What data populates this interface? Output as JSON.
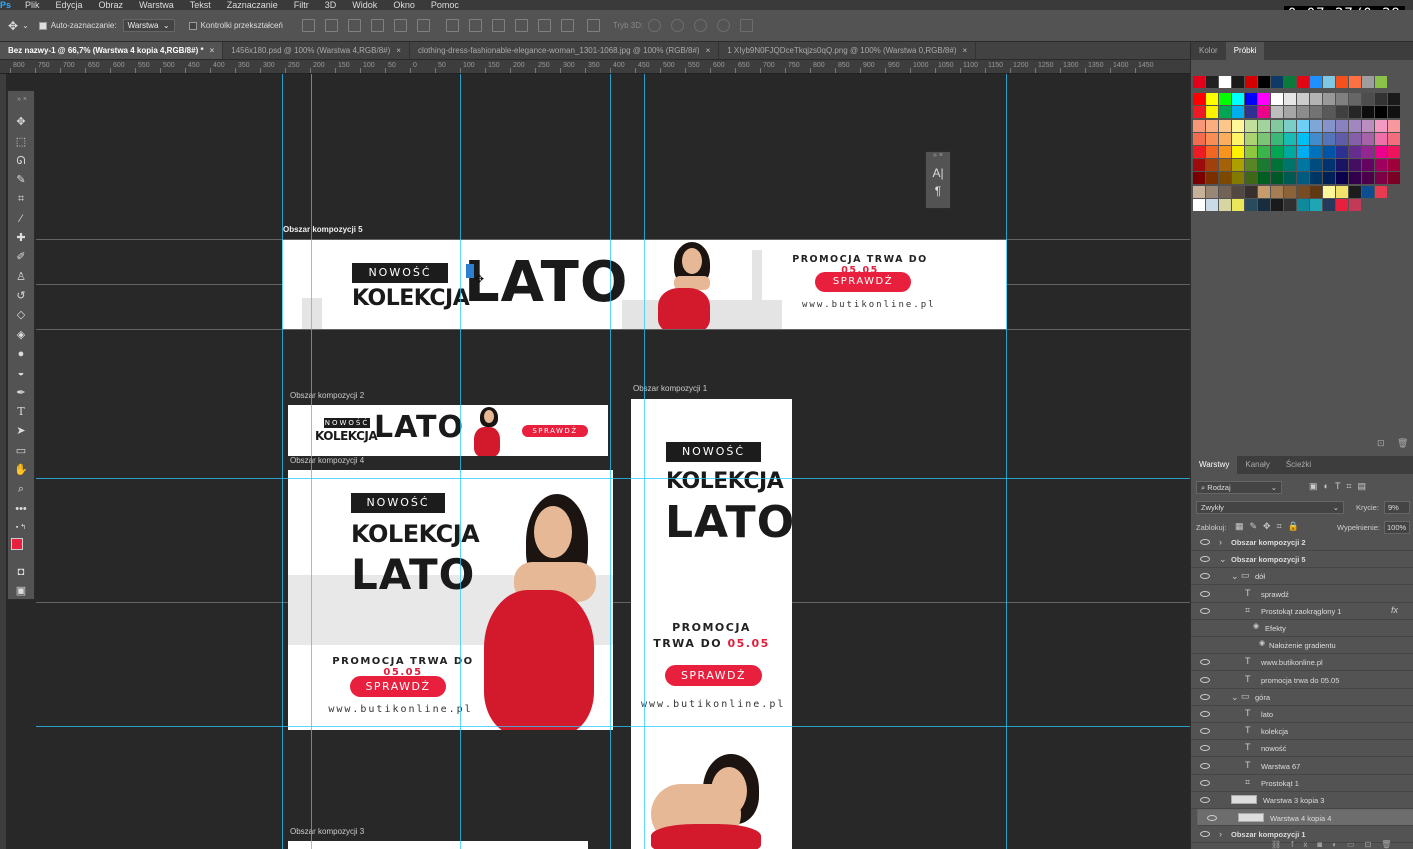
{
  "menu": {
    "app_logo": "Ps",
    "items": [
      "Plik",
      "Edycja",
      "Obraz",
      "Warstwa",
      "Tekst",
      "Zaznaczanie",
      "Filtr",
      "3D",
      "Widok",
      "Okno",
      "Pomoc"
    ]
  },
  "timer": "0:07:27/0:29",
  "options": {
    "auto_select_label": "Auto-zaznaczanie:",
    "auto_select_value": "Warstwa",
    "transform_controls_label": "Kontrolki przekształceń",
    "mode_3d_label": "Tryb 3D:"
  },
  "doc_tabs": [
    {
      "label": "Bez nazwy-1 @ 66,7% (Warstwa 4 kopia 4,RGB/8#) *",
      "active": true
    },
    {
      "label": "1456x180.psd @ 100% (Warstwa 4,RGB/8#)",
      "active": false
    },
    {
      "label": "clothing-dress-fashionable-elegance-woman_1301-1068.jpg @ 100% (RGB/8#)",
      "active": false
    },
    {
      "label": "1 XIyb9N0FJQDceTkqjzs0qQ.png @ 100% (Warstwa 0,RGB/8#)",
      "active": false
    }
  ],
  "ruler_labels": [
    "800",
    "750",
    "700",
    "650",
    "600",
    "550",
    "500",
    "450",
    "400",
    "350",
    "300",
    "250",
    "200",
    "150",
    "100",
    "50",
    "0",
    "50",
    "100",
    "150",
    "200",
    "250",
    "300",
    "350",
    "400",
    "450",
    "500",
    "550",
    "600",
    "650",
    "700",
    "750",
    "800",
    "850",
    "900",
    "950",
    "1000",
    "1050",
    "1100",
    "1150",
    "1200",
    "1250",
    "1300",
    "1350",
    "1400",
    "1450"
  ],
  "artboards": {
    "a5": {
      "label": "Obszar kompozycji 5",
      "nowosc": "NOWOŚĆ",
      "kolekcja": "KOLEKCJA",
      "lato": "LATO",
      "promo": "PROMOCJA TRWA DO",
      "date": "05.05",
      "button": "SPRAWDŹ",
      "www": "www.butikonline.pl"
    },
    "a2": {
      "label": "Obszar kompozycji 2",
      "nowosc": "NOWOŚĆ",
      "kolekcja": "KOLEKCJA",
      "lato": "LATO",
      "button": "SPRAWDŹ"
    },
    "a4": {
      "label": "Obszar kompozycji 4",
      "nowosc": "NOWOŚĆ",
      "kolekcja": "KOLEKCJA",
      "lato": "LATO",
      "promo": "PROMOCJA TRWA DO",
      "date": "05.05",
      "button": "SPRAWDŹ",
      "www": "www.butikonline.pl"
    },
    "a1": {
      "label": "Obszar kompozycji 1",
      "nowosc": "NOWOŚĆ",
      "kolekcja": "KOLEKCJA",
      "lato": "LATO",
      "promo1": "PROMOCJA",
      "promo2": "TRWA DO",
      "date": "05.05",
      "button": "SPRAWDŹ",
      "www": "www.butikonline.pl"
    },
    "a3": {
      "label": "Obszar kompozycji 3"
    }
  },
  "mini_panel": {
    "char_glyph": "A|",
    "para_glyph": "¶"
  },
  "color_panel": {
    "tabs": [
      "Kolor",
      "Próbki"
    ],
    "active": "Próbki"
  },
  "swatch_rows": [
    [
      "#e2001a",
      "#222222",
      "#ffffff",
      "#1a1a1a",
      "#d40000",
      "#000000",
      "#0d3b66",
      "#0b7a3b",
      "#e30613",
      "#1e90ff",
      "#7ec8e3",
      "#f4511e",
      "#ff7043",
      "#9e9e9e",
      "#8bc34a"
    ],
    [
      "#ff0000",
      "#ffff00",
      "#00ff00",
      "#00ffff",
      "#0000ff",
      "#ff00ff",
      "#ffffff",
      "#e6e6e6",
      "#cccccc",
      "#b3b3b3",
      "#999999",
      "#808080",
      "#666666",
      "#4d4d4d",
      "#333333",
      "#1a1a1a"
    ],
    [
      "#ed1c24",
      "#fff200",
      "#00a651",
      "#00aeef",
      "#2e3192",
      "#ec008c",
      "#bdbdbd",
      "#a6a6a6",
      "#8c8c8c",
      "#737373",
      "#595959",
      "#404040",
      "#262626",
      "#0d0d0d",
      "#000000",
      "#111111"
    ],
    [
      "#f7977a",
      "#f9ad81",
      "#fdc68a",
      "#fff79a",
      "#c4df9b",
      "#a3d39c",
      "#82ca9d",
      "#7bcdc8",
      "#6ecff6",
      "#7ea7d8",
      "#8493ca",
      "#8882be",
      "#a187be",
      "#bc8dbf",
      "#f49ac2",
      "#f6989d"
    ],
    [
      "#f26c4f",
      "#f68e55",
      "#fbaf5c",
      "#fff467",
      "#acd372",
      "#7cc576",
      "#3bb878",
      "#1abbb4",
      "#00bff3",
      "#438ccb",
      "#5574b9",
      "#605ca8",
      "#855fa8",
      "#a763a8",
      "#f06ea9",
      "#f26d7d"
    ],
    [
      "#ed1c24",
      "#f26522",
      "#f7941d",
      "#fff200",
      "#8dc63f",
      "#39b54a",
      "#00a651",
      "#00a99d",
      "#00aeef",
      "#0072bc",
      "#0054a6",
      "#2e3192",
      "#662d91",
      "#92278f",
      "#ec008c",
      "#ed145b"
    ],
    [
      "#9e0b0f",
      "#a0410d",
      "#a36209",
      "#aba000",
      "#598527",
      "#1a7b30",
      "#007236",
      "#00746b",
      "#0076a3",
      "#004b80",
      "#003471",
      "#1b1464",
      "#440e62",
      "#630460",
      "#9e005d",
      "#9e0039"
    ],
    [
      "#790000",
      "#7b2e00",
      "#7d4900",
      "#827b00",
      "#406618",
      "#005e20",
      "#005826",
      "#005952",
      "#005b7f",
      "#003663",
      "#002157",
      "#0d004c",
      "#32004b",
      "#4b0049",
      "#7b0046",
      "#7a0026"
    ],
    [
      "#c7b299",
      "#998675",
      "#736357",
      "#534741",
      "#37302d",
      "#c69c6d",
      "#a67c52",
      "#8c6239",
      "#754c24",
      "#603913",
      "#fff799",
      "#f2e26b",
      "#1c1c1c",
      "#0e4d8f",
      "#e83a52"
    ],
    [
      "#ffffff",
      "#c8dbe6",
      "#d6d6a4",
      "#e8e85a",
      "#2a4a5e",
      "#172c3c",
      "#1a1a1a",
      "#303030",
      "#0f8a9a",
      "#1fa6b5",
      "#253a5a",
      "#e8203d",
      "#c43956"
    ]
  ],
  "layers_panel": {
    "tabs": [
      "Warstwy",
      "Kanały",
      "Ścieżki"
    ],
    "active": "Warstwy",
    "filter_label": "Rodzaj",
    "blend_mode": "Zwykły",
    "opacity_label": "Krycie:",
    "opacity_value": "9%",
    "lock_label": "Zablokuj:",
    "fill_label": "Wypełnienie:",
    "fill_value": "100%",
    "rows": [
      {
        "name": "Obszar kompozycji 2",
        "kind": "artboard",
        "indent": 0,
        "bold": true,
        "selected": false
      },
      {
        "name": "Obszar kompozycji 5",
        "kind": "artboard",
        "indent": 0,
        "bold": true,
        "selected": false
      },
      {
        "name": "dół",
        "kind": "folder",
        "indent": 1,
        "bold": false,
        "selected": false
      },
      {
        "name": "sprawdź",
        "kind": "text",
        "indent": 2,
        "bold": false,
        "selected": false
      },
      {
        "name": "Prostokąt zaokrąglony 1",
        "kind": "shape",
        "indent": 2,
        "bold": false,
        "selected": false,
        "fx": "fx"
      },
      {
        "name": "Efekty",
        "kind": "effects",
        "indent": 3,
        "bold": false,
        "selected": false
      },
      {
        "name": "Nałożenie gradientu",
        "kind": "effect",
        "indent": 4,
        "bold": false,
        "selected": false
      },
      {
        "name": "www.butikonline.pl",
        "kind": "text",
        "indent": 2,
        "bold": false,
        "selected": false
      },
      {
        "name": "promocja trwa do 05.05",
        "kind": "text",
        "indent": 2,
        "bold": false,
        "selected": false
      },
      {
        "name": "góra",
        "kind": "folder",
        "indent": 1,
        "bold": false,
        "selected": false
      },
      {
        "name": "lato",
        "kind": "text",
        "indent": 2,
        "bold": false,
        "selected": false
      },
      {
        "name": "kolekcja",
        "kind": "text",
        "indent": 2,
        "bold": false,
        "selected": false
      },
      {
        "name": "nowość",
        "kind": "text",
        "indent": 2,
        "bold": false,
        "selected": false
      },
      {
        "name": "Warstwa 67",
        "kind": "text",
        "indent": 2,
        "bold": false,
        "selected": false
      },
      {
        "name": "Prostokąt 1",
        "kind": "shape",
        "indent": 2,
        "bold": false,
        "selected": false
      },
      {
        "name": "Warstwa 3 kopia 3",
        "kind": "pixel",
        "indent": 1,
        "bold": false,
        "selected": false
      },
      {
        "name": "Warstwa 4 kopia 4",
        "kind": "pixel",
        "indent": 1,
        "bold": false,
        "selected": true
      },
      {
        "name": "Obszar kompozycji 1",
        "kind": "artboard",
        "indent": 0,
        "bold": true,
        "selected": false
      }
    ]
  }
}
